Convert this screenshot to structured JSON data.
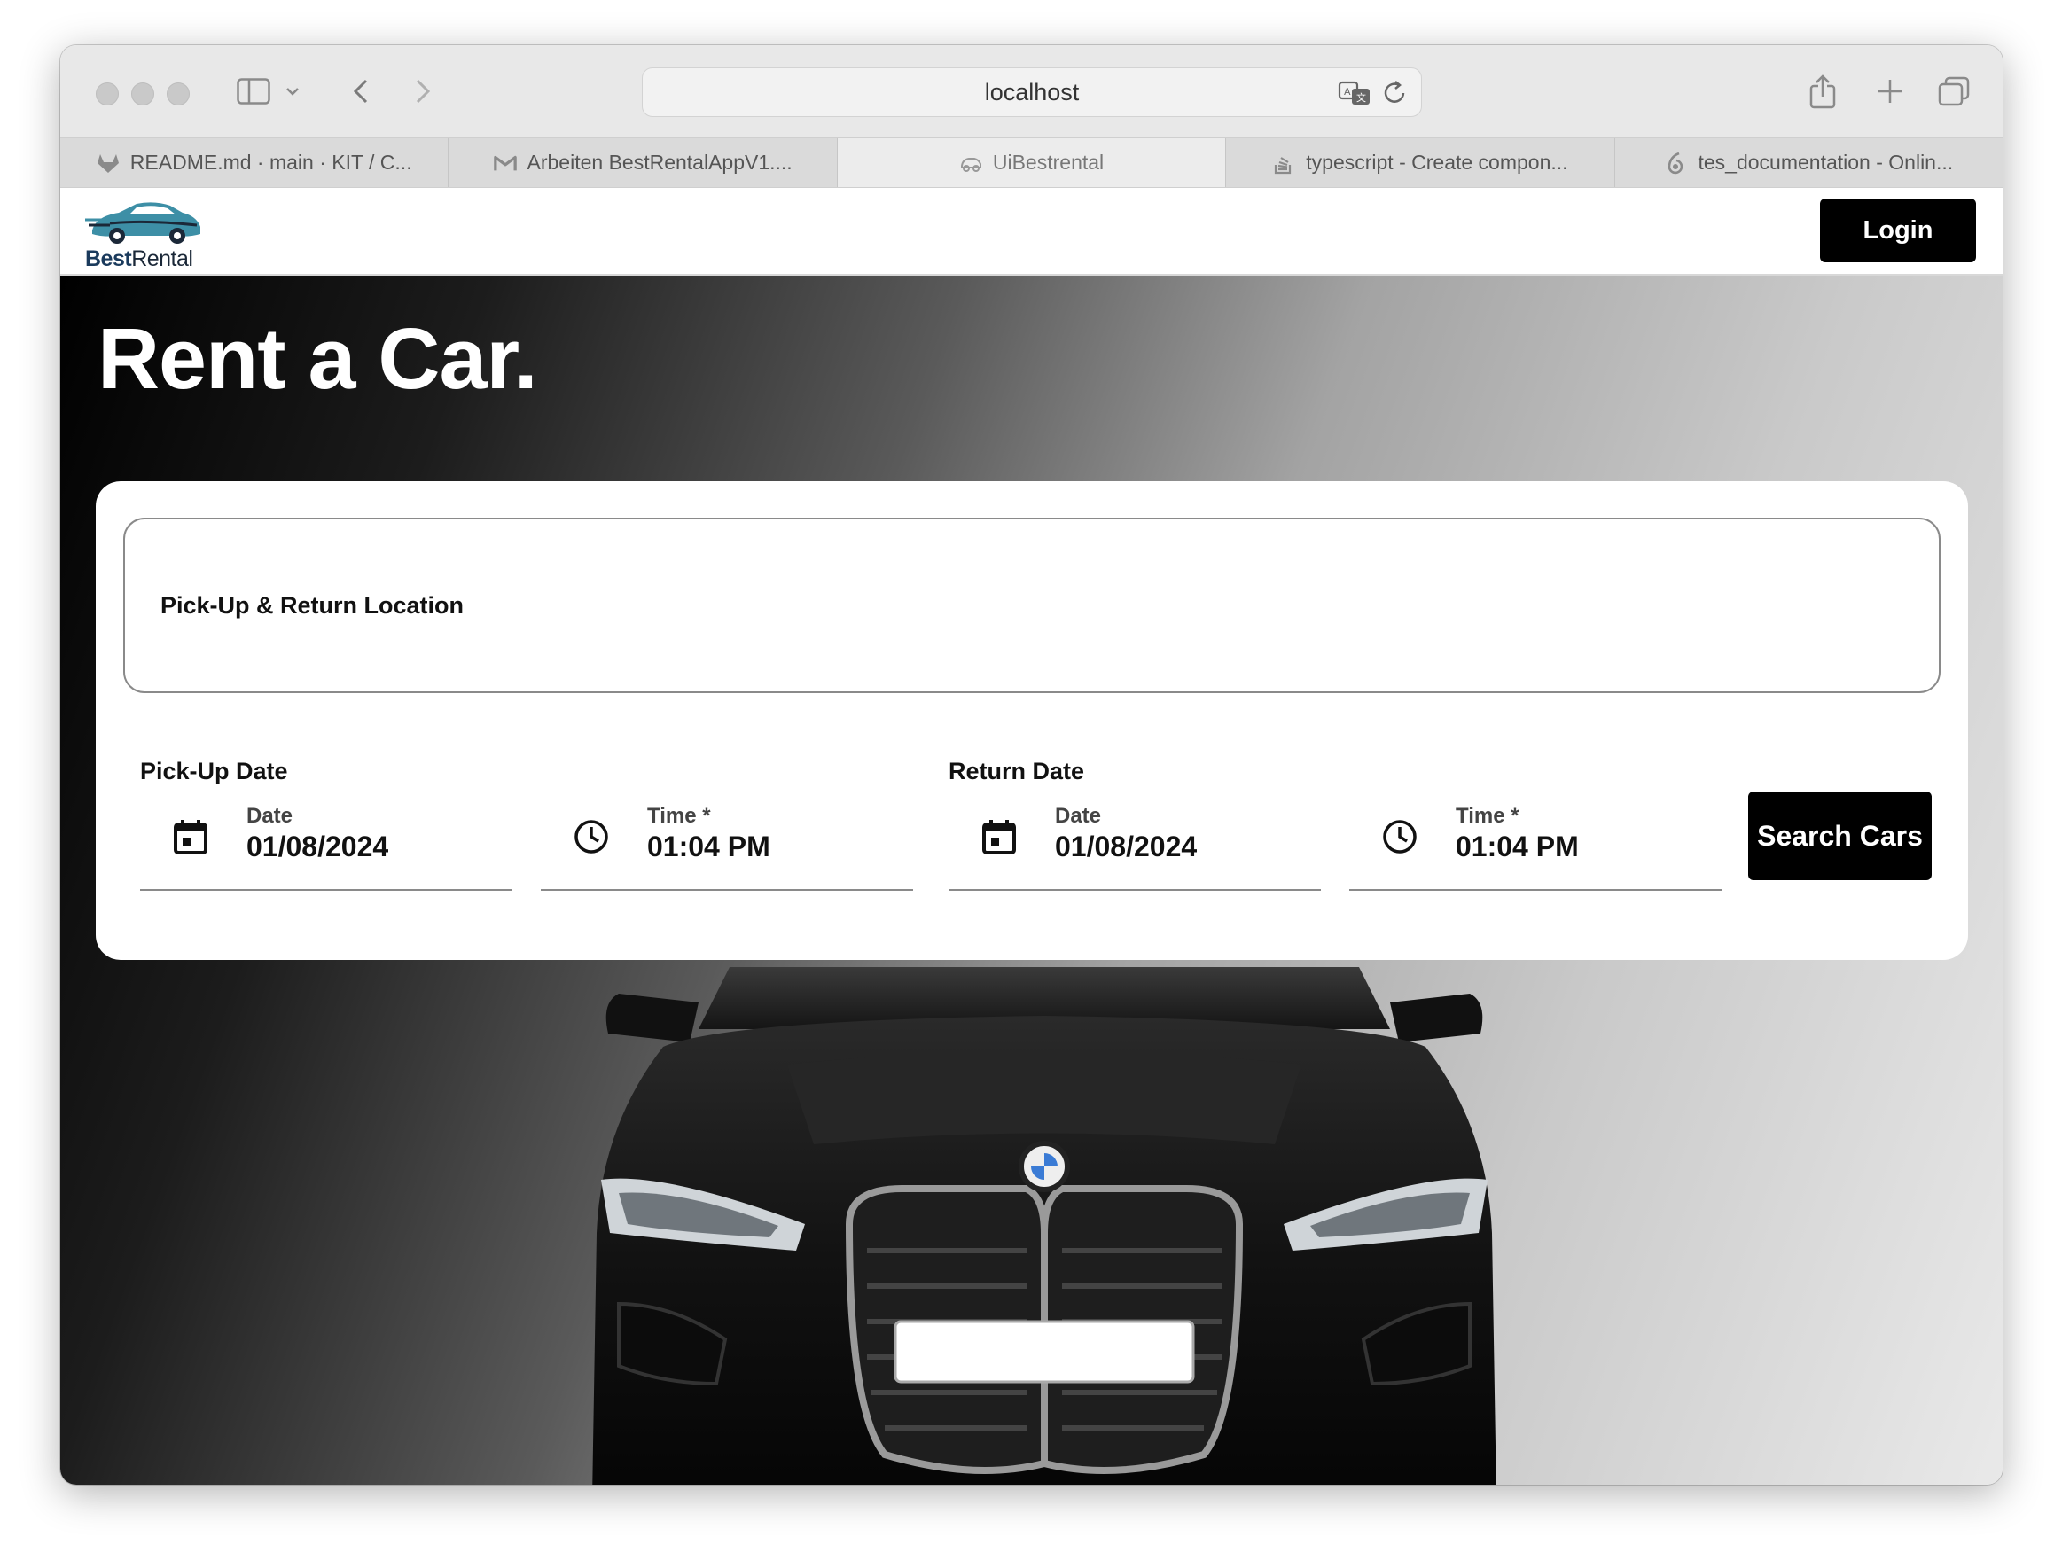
{
  "browser": {
    "address": "localhost",
    "tabs": [
      {
        "label": "README.md · main · KIT / C...",
        "icon": "gitlab-icon",
        "active": false
      },
      {
        "label": "Arbeiten BestRentalAppV1....",
        "icon": "gmail-icon",
        "active": false
      },
      {
        "label": "UiBestrental",
        "icon": "app-favicon-icon",
        "active": true
      },
      {
        "label": "typescript - Create compon...",
        "icon": "stackoverflow-icon",
        "active": false
      },
      {
        "label": "tes_documentation - Onlin...",
        "icon": "overleaf-icon",
        "active": false
      }
    ]
  },
  "navbar": {
    "logo_bold": "Best",
    "logo_regular": "Rental",
    "login_label": "Login"
  },
  "hero": {
    "title": "Rent a Car."
  },
  "search": {
    "location_label": "Pick-Up & Return Location",
    "pickup": {
      "group_label": "Pick-Up Date",
      "date_label": "Date",
      "date_value": "01/08/2024",
      "time_label": "Time *",
      "time_value": "01:04 PM"
    },
    "return": {
      "group_label": "Return Date",
      "date_label": "Date",
      "date_value": "01/08/2024",
      "time_label": "Time *",
      "time_value": "01:04 PM"
    },
    "submit_label": "Search Cars"
  }
}
